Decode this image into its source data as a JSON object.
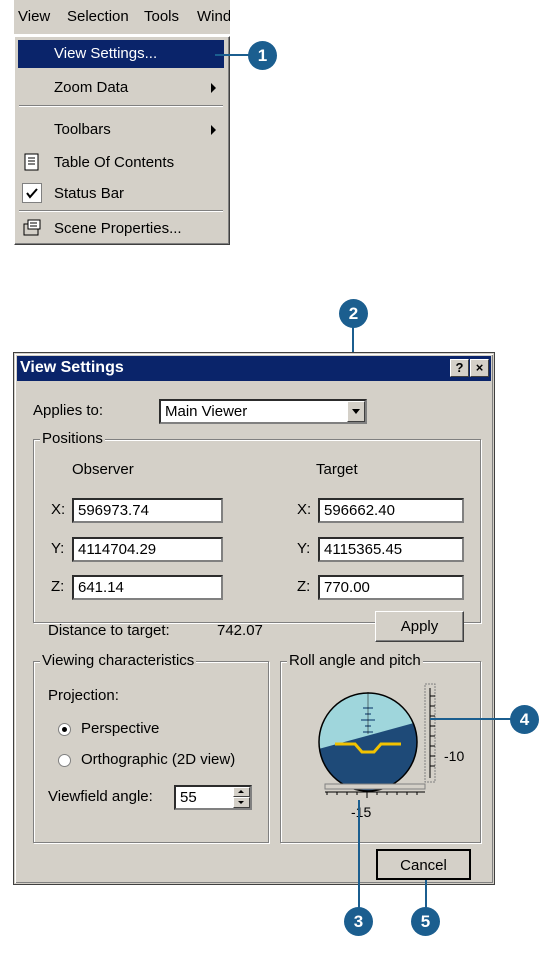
{
  "menubar": {
    "items": [
      "View",
      "Selection",
      "Tools",
      "Wind"
    ]
  },
  "menu": {
    "items": [
      {
        "label": "View Settings...",
        "selected": true
      },
      {
        "label": "Zoom Data",
        "submenu": true
      },
      {
        "label": "Toolbars",
        "submenu": true
      },
      {
        "label": "Table Of Contents",
        "icon": "table-of-contents-icon"
      },
      {
        "label": "Status Bar",
        "icon": "checkmark-icon"
      },
      {
        "label": "Scene Properties...",
        "icon": "scene-properties-icon"
      }
    ]
  },
  "callouts": [
    "1",
    "2",
    "3",
    "4",
    "5"
  ],
  "dialog": {
    "title": "View Settings",
    "help_btn": "?",
    "close_btn": "×",
    "applies_to_label": "Applies to:",
    "applies_to_value": "Main Viewer",
    "positions": {
      "title": "Positions",
      "observer_label": "Observer",
      "target_label": "Target",
      "observer": {
        "x_label": "X:",
        "y_label": "Y:",
        "z_label": "Z:",
        "x": "596973.74",
        "y": "4114704.29",
        "z": "641.14"
      },
      "target": {
        "x_label": "X:",
        "y_label": "Y:",
        "z_label": "Z:",
        "x": "596662.40",
        "y": "4115365.45",
        "z": "770.00"
      },
      "distance_label": "Distance to target:",
      "distance_value": "742.07",
      "apply_label": "Apply"
    },
    "viewing": {
      "title": "Viewing characteristics",
      "projection_label": "Projection:",
      "perspective_label": "Perspective",
      "orthographic_label": "Orthographic (2D view)",
      "selected_projection": "Perspective",
      "viewfield_label": "Viewfield angle:",
      "viewfield_value": "55"
    },
    "roll": {
      "title": "Roll angle and pitch",
      "pitch_value": "-10",
      "roll_value": "-15"
    },
    "cancel_label": "Cancel"
  },
  "colors": {
    "accent": "#1b5e8f",
    "titlebar": "#0a246a",
    "sky": "#9fd6dc",
    "ground": "#1e4a78",
    "aircraft": "#f2c200"
  }
}
